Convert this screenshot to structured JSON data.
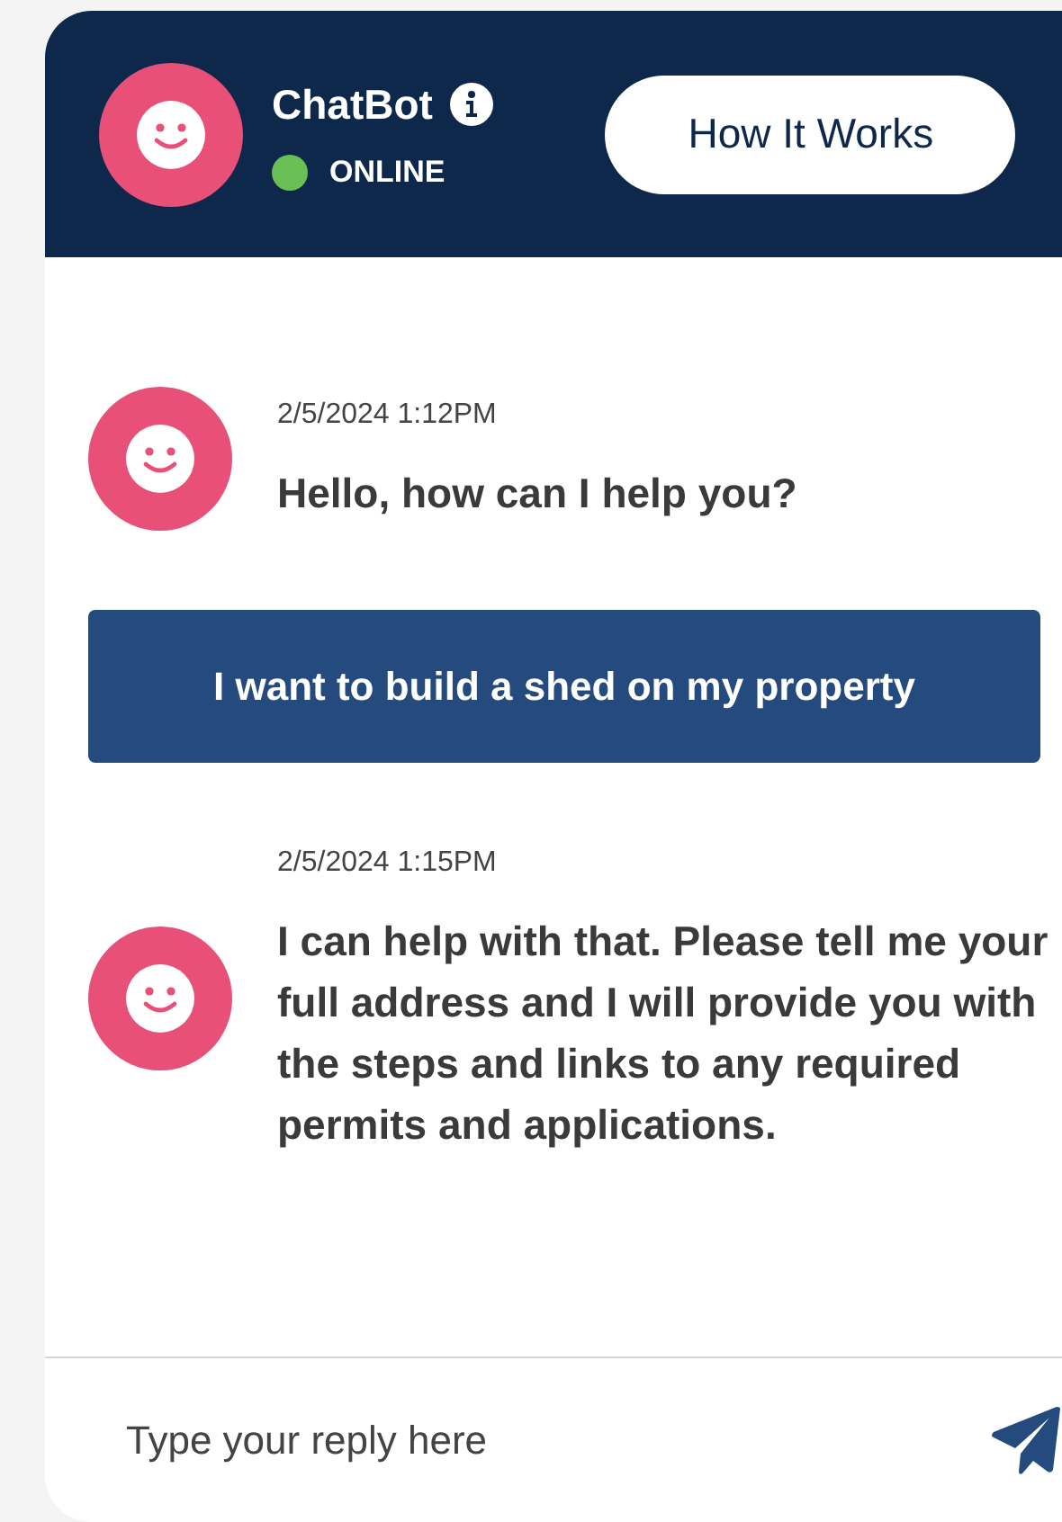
{
  "header": {
    "bot_name": "ChatBot",
    "status": {
      "label": "ONLINE",
      "color": "#6abf54"
    },
    "how_it_works_button": "How It Works"
  },
  "messages": [
    {
      "kind": "bot",
      "timestamp": "2/5/2024 1:12PM",
      "text": "Hello, how can I help you?"
    },
    {
      "kind": "user",
      "text": "I want to build a shed on my property"
    },
    {
      "kind": "bot",
      "timestamp": "2/5/2024 1:15PM",
      "text": "I can help with that. Please tell me your full address and I will provide you with the steps and links to any required permits and applications."
    }
  ],
  "reply": {
    "placeholder": "Type your reply here"
  }
}
